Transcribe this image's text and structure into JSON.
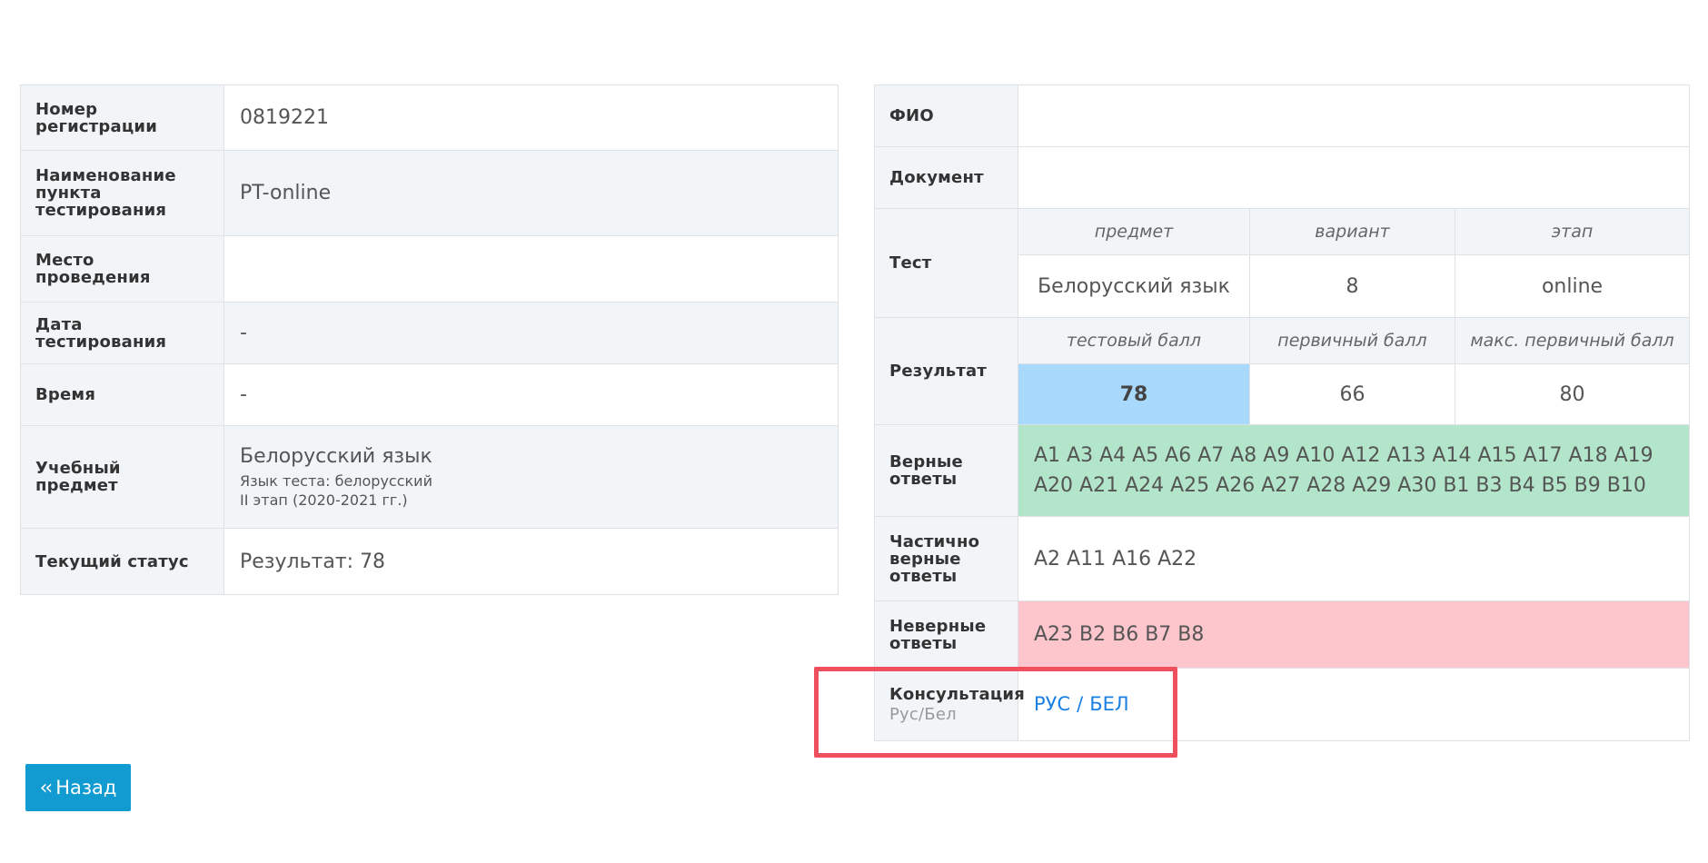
{
  "left_table": {
    "rows": [
      {
        "label": "Номер регистрации",
        "value": "0819221"
      },
      {
        "label": "Наименование пункта тестирования",
        "value": "PT-online"
      },
      {
        "label": "Место проведения",
        "value": ""
      },
      {
        "label": "Дата тестирования",
        "value": "-"
      },
      {
        "label": "Время",
        "value": "-"
      },
      {
        "label": "Учебный предмет",
        "value": "Белорусский язык",
        "detail1": "Язык теста: белорусский",
        "detail2": "II этап (2020-2021 гг.)"
      },
      {
        "label": "Текущий статус",
        "value": "Результат: 78"
      }
    ]
  },
  "right_table": {
    "fio": {
      "label": "ФИО",
      "value": ""
    },
    "document": {
      "label": "Документ",
      "value": ""
    },
    "test": {
      "label": "Тест",
      "headers": [
        "предмет",
        "вариант",
        "этап"
      ],
      "values": [
        "Белорусский язык",
        "8",
        "online"
      ]
    },
    "result": {
      "label": "Результат",
      "headers": [
        "тестовый балл",
        "первичный балл",
        "макс. первичный балл"
      ],
      "values": [
        "78",
        "66",
        "80"
      ]
    },
    "correct": {
      "label": "Верные ответы",
      "value": "A1 A3 A4 A5 A6 A7 A8 A9 A10 A12 A13 A14 A15 A17 A18 A19 A20 A21 A24 A25 A26 A27 A28 A29 A30 B1 B3 B4 B5 B9 B10"
    },
    "partial": {
      "label": "Частично верные ответы",
      "value": "A2 A11 A16 A22"
    },
    "wrong": {
      "label": "Неверные ответы",
      "value": "A23 B2 B6 B7 B8"
    },
    "consult": {
      "label": "Консультация",
      "sublabel": "Рус/Бел",
      "link_rus": "РУС",
      "separator": "/",
      "link_bel": "БЕЛ"
    }
  },
  "back_button": {
    "label": "Назад",
    "icon": "double-chevron-left-icon"
  },
  "colors": {
    "score_bg": "#a8d8fb",
    "correct_bg": "#b2e5c9",
    "wrong_bg": "#fdc5cc",
    "link": "#1a7fe3",
    "button": "#129bd1",
    "highlight": "#f0505e"
  }
}
